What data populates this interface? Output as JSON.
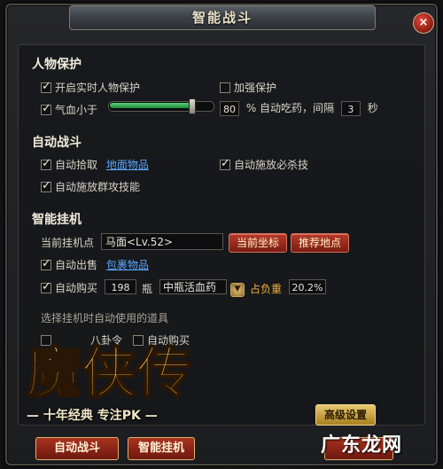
{
  "window": {
    "title": "智能战斗",
    "close_label": "×"
  },
  "protect": {
    "title": "人物保护",
    "realtime_label": "开启实时人物保护",
    "enhanced_label": "加强保护",
    "hp_label": "气血小于",
    "hp_percent": "80",
    "hp_percent_level": 0.8,
    "auto_potion_label": "% 自动吃药，间隔",
    "interval_value": "3",
    "interval_unit": "秒"
  },
  "auto_battle": {
    "title": "自动战斗",
    "pickup_label": "自动拾取",
    "pickup_link": "地面物品",
    "release_kill_label": "自动施放必杀技",
    "release_aoe_label": "自动施放群攻技能"
  },
  "hangup": {
    "title": "智能挂机",
    "point_label": "当前挂机点",
    "point_value": "马面<Lv.52>",
    "current_coord_btn": "当前坐标",
    "recommend_btn": "推荐地点",
    "sell_label": "自动出售",
    "sell_link": "包裹物品",
    "buy_label": "自动购买",
    "buy_qty": "198",
    "buy_unit": "瓶",
    "buy_item": "中瓶活血药",
    "weight_label": "占负重",
    "weight_value": "20.2%",
    "dropdown_icon": "▼"
  },
  "tools": {
    "title": "选择挂机时自动使用的道具",
    "item1": "八卦令",
    "item2": "自动购买"
  },
  "logo": {
    "title": "魔侠传",
    "slogan": "— 十年经典 专注PK —"
  },
  "buttons": {
    "advanced": "高级设置",
    "auto_battle": "自动战斗",
    "smart_hangup": "智能挂机"
  },
  "watermark": "广东龙网",
  "colors": {
    "link": "#5aa8ff",
    "accent_red": "#a8321e",
    "gold": "#e8c870",
    "slider_fill": "#1a8a3a"
  }
}
